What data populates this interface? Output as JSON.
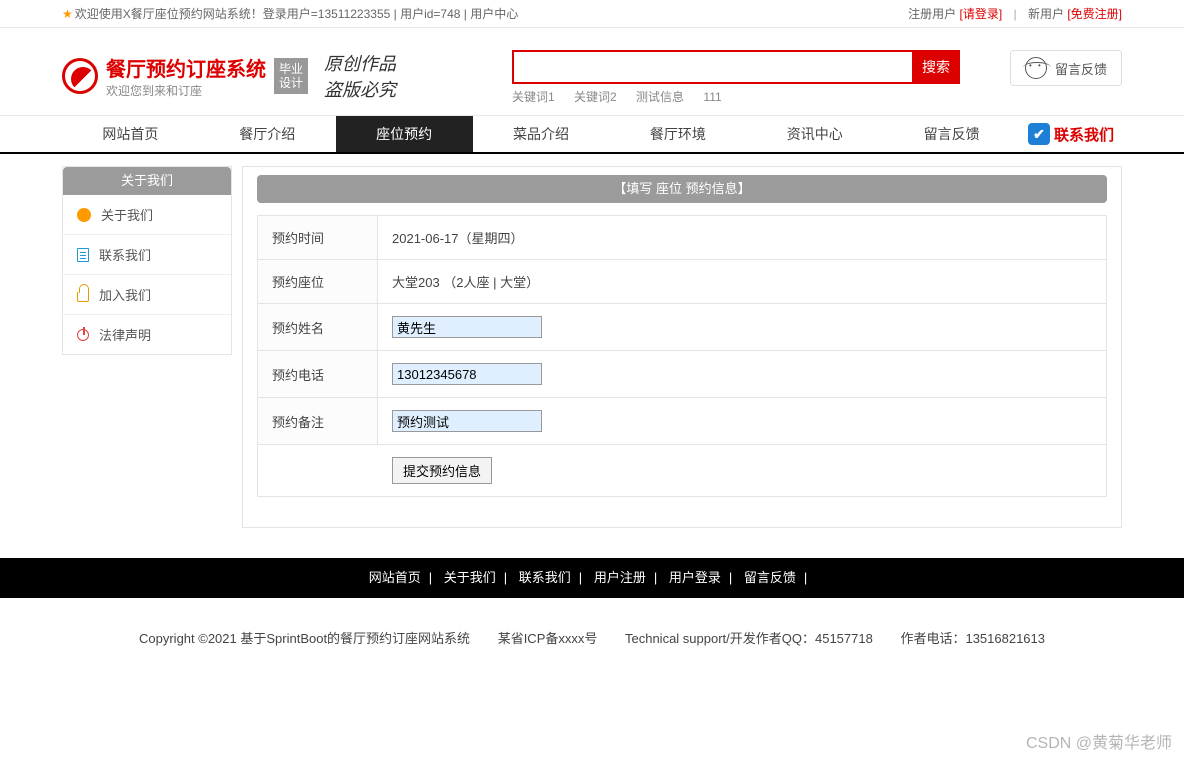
{
  "topbar": {
    "welcome": "欢迎使用X餐厅座位预约网站系统！登录用户=13511223355 | 用户id=748 | 用户中心",
    "registered_label": "注册用户",
    "login_link": "[请登录]",
    "new_user_label": "新用户",
    "register_link": "[免费注册]"
  },
  "header": {
    "title": "餐厅预约订座系统",
    "subtitle": "欢迎您到来和订座",
    "badge_line1": "毕业",
    "badge_line2": "设计",
    "motto_line1": "原创作品",
    "motto_line2": "盗版必究",
    "search_button": "搜索",
    "keywords": [
      "关键词1",
      "关键词2",
      "测试信息",
      "111"
    ],
    "feedback": "留言反馈"
  },
  "nav": {
    "items": [
      "网站首页",
      "餐厅介绍",
      "座位预约",
      "菜品介绍",
      "餐厅环境",
      "资讯中心",
      "留言反馈"
    ],
    "active_index": 2,
    "contact": "联系我们"
  },
  "sidebar": {
    "title": "关于我们",
    "items": [
      {
        "label": "关于我们",
        "icon": "dot-orange"
      },
      {
        "label": "联系我们",
        "icon": "doc"
      },
      {
        "label": "加入我们",
        "icon": "lock"
      },
      {
        "label": "法律声明",
        "icon": "power"
      }
    ]
  },
  "panel": {
    "title": "【填写 座位 预约信息】"
  },
  "form": {
    "rows": {
      "time_label": "预约时间",
      "time_value": "2021-06-17（星期四）",
      "seat_label": "预约座位",
      "seat_value": "大堂203 （2人座 | 大堂）",
      "name_label": "预约姓名",
      "name_value": "黄先生",
      "phone_label": "预约电话",
      "phone_value": "13012345678",
      "remark_label": "预约备注",
      "remark_value": "预约测试"
    },
    "submit": "提交预约信息"
  },
  "footer": {
    "nav": [
      "网站首页",
      "关于我们",
      "联系我们",
      "用户注册",
      "用户登录",
      "留言反馈"
    ],
    "copy1": "Copyright ©2021 基于SprintBoot的餐厅预约订座网站系统",
    "copy2": "某省ICP备xxxx号",
    "copy3": "Technical support/开发作者QQ：45157718",
    "copy4": "作者电话：13516821613"
  },
  "watermark": "CSDN @黄菊华老师"
}
